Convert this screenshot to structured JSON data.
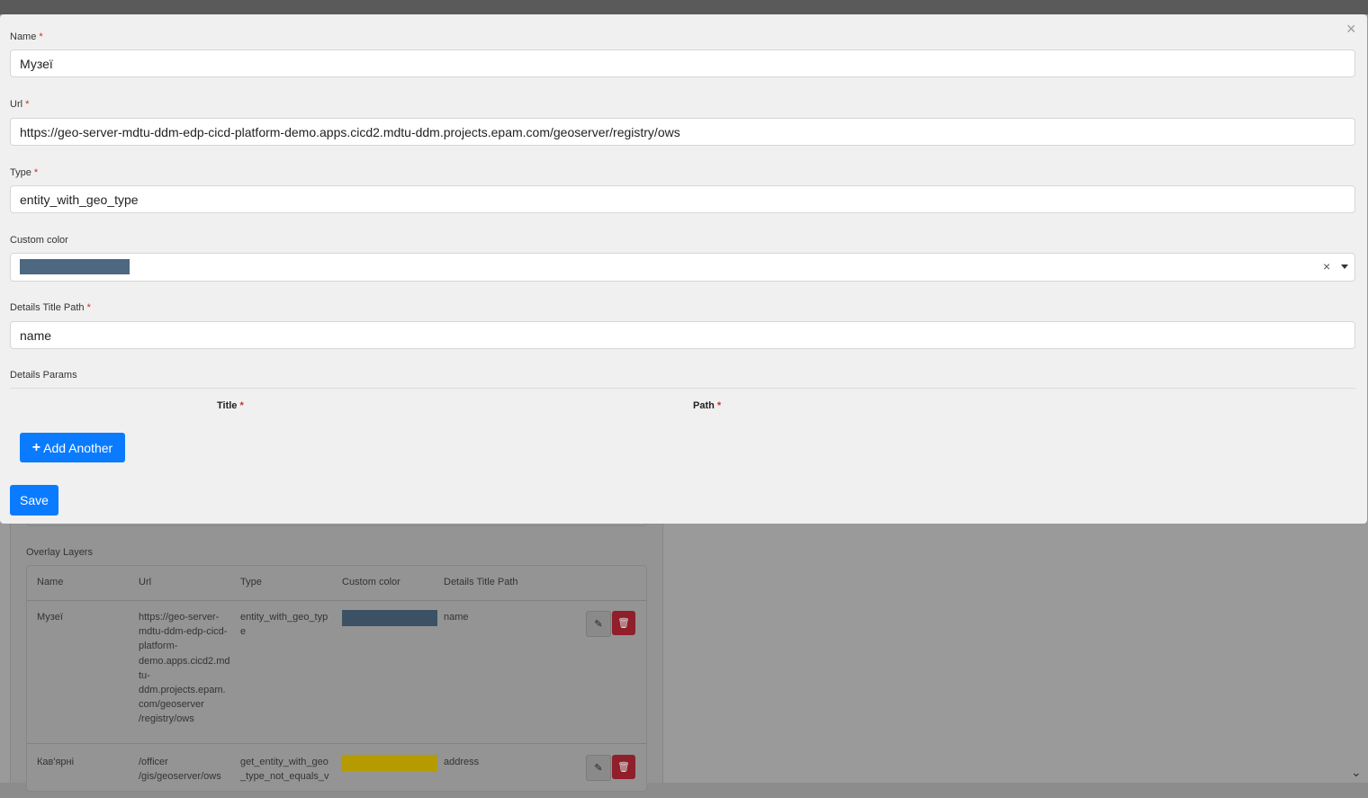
{
  "modal": {
    "fields": {
      "name": {
        "label": "Name",
        "required": "*",
        "value": "Музеї"
      },
      "url": {
        "label": "Url",
        "required": "*",
        "value": "https://geo-server-mdtu-ddm-edp-cicd-platform-demo.apps.cicd2.mdtu-ddm.projects.epam.com/geoserver/registry/ows"
      },
      "type": {
        "label": "Type",
        "required": "*",
        "value": "entity_with_geo_type"
      },
      "custom_color": {
        "label": "Custom color",
        "value_color": "#4d6880",
        "clear": "×"
      },
      "details_title_path": {
        "label": "Details Title Path",
        "required": "*",
        "value": "name"
      }
    },
    "details_params": {
      "label": "Details Params",
      "columns": [
        {
          "label": "Title",
          "required": "*"
        },
        {
          "label": "Path",
          "required": "*"
        }
      ]
    },
    "add_another_label": "Add Another",
    "add_icon": "+",
    "save_label": "Save",
    "close_icon": "×"
  },
  "background": {
    "overlay_label": "Overlay Layers",
    "table": {
      "headers": [
        "Name",
        "Url",
        "Type",
        "Custom color",
        "Details Title Path"
      ],
      "rows": [
        {
          "name": "Музеї",
          "url": "https://geo-server-\nmdtu-ddm-edp-cicd-\nplatform-\ndemo.apps.cicd2.md\ntu-\nddm.projects.epam.\ncom/geoserver\n/registry/ows",
          "type": "entity_with_geo_typ\ne",
          "color": "#3c5264",
          "title_path": "name"
        },
        {
          "name": "Кав'ярні",
          "url": "/officer\n/gis/geoserver/ows",
          "type": "get_entity_with_geo\n_type_not_equals_v",
          "color": "#b59a00",
          "title_path": "address"
        }
      ]
    }
  }
}
